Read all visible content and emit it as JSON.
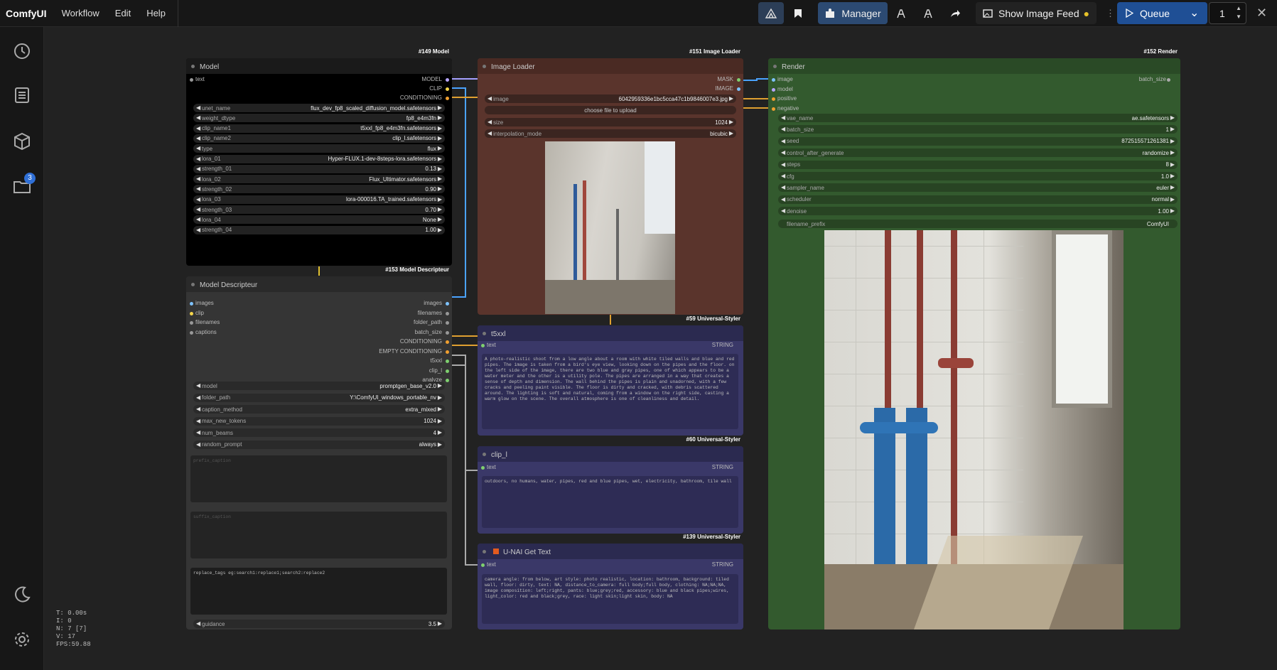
{
  "app": {
    "brand": "ComfyUI",
    "menu": [
      "Workflow",
      "Edit",
      "Help"
    ]
  },
  "toolbar": {
    "manager": "Manager",
    "show_image_feed": "Show Image Feed",
    "queue": "Queue",
    "queue_count": "1"
  },
  "sidebar": {
    "queue_badge": "3"
  },
  "stats": [
    "T: 0.00s",
    "I: 0",
    "N: 7 [7]",
    "V: 17",
    "FPS:59.88"
  ],
  "model_node": {
    "id": "#149 Model",
    "title": "Model",
    "input": "text",
    "outputs": [
      "MODEL",
      "CLIP",
      "CONDITIONING"
    ],
    "widgets": [
      [
        "unet_name",
        "flux_dev_fp8_scaled_diffusion_model.safetensors"
      ],
      [
        "weight_dtype",
        "fp8_e4m3fn"
      ],
      [
        "clip_name1",
        "t5xxl_fp8_e4m3fn.safetensors"
      ],
      [
        "clip_name2",
        "clip_l.safetensors"
      ],
      [
        "type",
        "flux"
      ],
      [
        "lora_01",
        "Hyper-FLUX.1-dev-8steps-lora.safetensors"
      ],
      [
        "strength_01",
        "0.13"
      ],
      [
        "lora_02",
        "Flux_Ultimator.safetensors"
      ],
      [
        "strength_02",
        "0.90"
      ],
      [
        "lora_03",
        "lora-000016.TA_trained.safetensors"
      ],
      [
        "strength_03",
        "0.70"
      ],
      [
        "lora_04",
        "None"
      ],
      [
        "strength_04",
        "1.00"
      ]
    ]
  },
  "descr_node": {
    "id": "#153 Model Descripteur",
    "title": "Model Descripteur",
    "inputs": [
      "images",
      "clip",
      "filenames",
      "captions"
    ],
    "outputs": [
      "images",
      "filenames",
      "folder_path",
      "batch_size",
      "CONDITIONING",
      "EMPTY CONDITIONING",
      "t5xxl",
      "clip_l",
      "analyze"
    ],
    "widgets": [
      [
        "model",
        "promptgen_base_v2.0"
      ],
      [
        "folder_path",
        "Y:\\ComfyUI_windows_portable_nv"
      ],
      [
        "caption_method",
        "extra_mixed"
      ],
      [
        "max_new_tokens",
        "1024"
      ],
      [
        "num_beams",
        "4"
      ],
      [
        "random_prompt",
        "always"
      ]
    ],
    "prefix_caption": "prefix_caption",
    "suffix_caption": "suffix_caption",
    "replace_tags": "replace_tags eg:search1:replace1;search2:replace2",
    "guidance": [
      "guidance",
      "3.5"
    ]
  },
  "loader_node": {
    "id": "#151 Image Loader",
    "title": "Image Loader",
    "outputs": [
      "MASK",
      "IMAGE"
    ],
    "image": [
      "image",
      "6042959336e1bc5cca47c1b9846007e3.jpg"
    ],
    "upload": "choose file to upload",
    "size": [
      "size",
      "1024"
    ],
    "interp": [
      "interpolation_mode",
      "bicubic"
    ]
  },
  "t5_node": {
    "id": "#59 Universal-Styler",
    "title": "t5xxl",
    "port": "text",
    "type": "STRING",
    "text": "A photo-realistic shoot from a low angle about a room with white tiled walls and blue and red pipes. The image is taken from a bird's eye view, looking down on the pipes and the floor. on the left side of the image, there are two blue and gray pipes, one of which appears to be a water meter and the other is a utility pole. The pipes are arranged in a way that creates a sense of depth and dimension. The wall behind the pipes is plain and unadorned, with a few cracks and peeling paint visible. The floor is dirty and cracked, with debris scattered around. The lighting is soft and natural, coming from a window on the right side, casting a warm glow on the scene. The overall atmosphere is one of cleanliness and detail."
  },
  "clip_node": {
    "id": "#60 Universal-Styler",
    "title": "clip_l",
    "port": "text",
    "type": "STRING",
    "text": "outdoors, no humans, water, pipes, red and blue pipes, wet, electricity, bathroom, tile wall"
  },
  "gettext_node": {
    "id": "#139 Universal-Styler",
    "title": "U-NAI Get Text",
    "port": "text",
    "type": "STRING",
    "text": "camera angle: from below, art style: photo realistic, location: bathroom, background: tiled wall, floor: dirty, text: NA, distance_to_camera: full body;full body, clothing: NA;NA;NA, image composition: left;right, pants: blue;grey;red, accessory: blue and black pipes;wires, light_color: red and black;grey, race: light skin;light skin, body: NA"
  },
  "render_node": {
    "id": "#152 Render",
    "title": "Render",
    "inputs": [
      "image",
      "model",
      "positive",
      "negative"
    ],
    "batch_out": "batch_size",
    "widgets": [
      [
        "vae_name",
        "ae.safetensors"
      ],
      [
        "batch_size",
        "1"
      ],
      [
        "seed",
        "872515571261381"
      ],
      [
        "control_after_generate",
        "randomize"
      ],
      [
        "steps",
        "8"
      ],
      [
        "cfg",
        "1.0"
      ],
      [
        "sampler_name",
        "euler"
      ],
      [
        "scheduler",
        "normal"
      ],
      [
        "denoise",
        "1.00"
      ]
    ],
    "filename_prefix": [
      "filename_prefix",
      "ComfyUI"
    ]
  }
}
